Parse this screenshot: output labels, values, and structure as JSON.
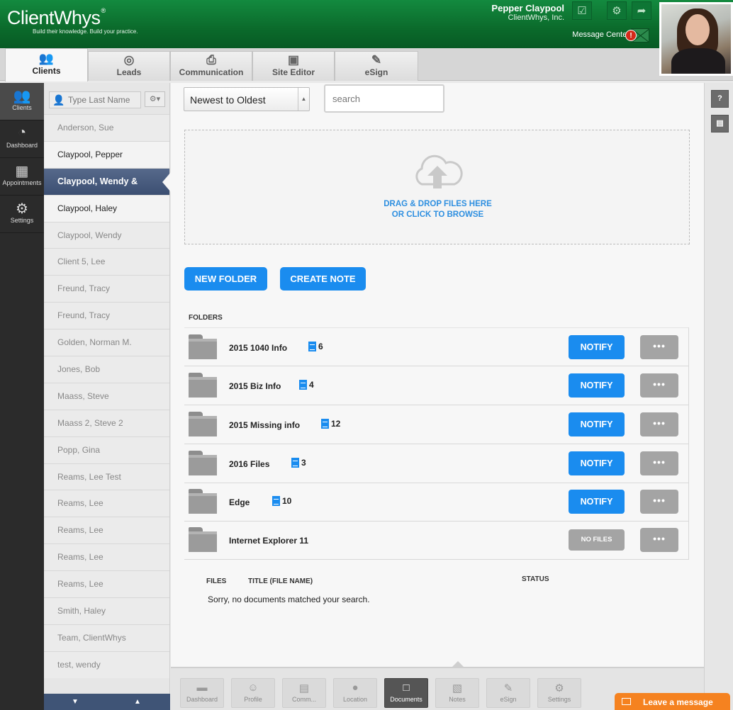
{
  "header": {
    "logo": "ClientWhys",
    "logo_mark": "®",
    "tagline": "Build their knowledge. Build your practice.",
    "user_name": "Pepper Claypool",
    "company": "ClientWhys, Inc.",
    "message_center": "Message Center",
    "message_badge": "!",
    "icons": [
      "checkbox-icon",
      "gear-icon",
      "share-icon"
    ]
  },
  "topnav": {
    "tabs": [
      {
        "label": "Clients",
        "icon": "people-icon",
        "active": true
      },
      {
        "label": "Leads",
        "icon": "target-icon"
      },
      {
        "label": "Communication",
        "icon": "printer-icon"
      },
      {
        "label": "Site Editor",
        "icon": "window-icon"
      },
      {
        "label": "eSign",
        "icon": "pencil-icon"
      }
    ]
  },
  "rail": {
    "items": [
      {
        "label": "Clients",
        "icon": "people-icon",
        "active": true
      },
      {
        "label": "Dashboard",
        "icon": "gauge-icon"
      },
      {
        "label": "Appointments",
        "icon": "calendar-icon"
      },
      {
        "label": "Settings",
        "icon": "gear-icon"
      }
    ]
  },
  "clients": {
    "search_placeholder": "Type Last Name",
    "items": [
      {
        "name": "Anderson, Sue",
        "style": "light"
      },
      {
        "name": "Claypool, Pepper",
        "style": "dark"
      },
      {
        "name": "Claypool, Wendy &",
        "style": "selected"
      },
      {
        "name": "Claypool, Haley",
        "style": "dark"
      },
      {
        "name": "Claypool, Wendy",
        "style": "light"
      },
      {
        "name": "Client 5, Lee",
        "style": "light"
      },
      {
        "name": "Freund, Tracy",
        "style": "light"
      },
      {
        "name": "Freund, Tracy",
        "style": "light"
      },
      {
        "name": "Golden, Norman M.",
        "style": "light"
      },
      {
        "name": "Jones, Bob",
        "style": "light"
      },
      {
        "name": "Maass, Steve",
        "style": "light"
      },
      {
        "name": "Maass 2, Steve 2",
        "style": "light"
      },
      {
        "name": "Popp, Gina",
        "style": "light"
      },
      {
        "name": "Reams, Lee Test",
        "style": "light"
      },
      {
        "name": "Reams, Lee",
        "style": "light"
      },
      {
        "name": "Reams, Lee",
        "style": "light"
      },
      {
        "name": "Reams, Lee",
        "style": "light"
      },
      {
        "name": "Reams, Lee",
        "style": "light"
      },
      {
        "name": "Smith, Haley",
        "style": "light"
      },
      {
        "name": "Team, ClientWhys",
        "style": "light"
      },
      {
        "name": "test, wendy",
        "style": "light"
      }
    ]
  },
  "main": {
    "sort_value": "Newest to Oldest",
    "search_placeholder": "search",
    "drop_line1": "DRAG & DROP FILES HERE",
    "drop_line2": "OR CLICK TO BROWSE",
    "new_folder": "NEW FOLDER",
    "create_note": "CREATE NOTE",
    "folders_label": "FOLDERS",
    "notify_label": "NOTIFY",
    "no_files_label": "NO FILES",
    "more_label": "•••",
    "folders": [
      {
        "name": "2015 1040 Info",
        "count": "6",
        "has_files": true
      },
      {
        "name": "2015 Biz Info",
        "count": "4",
        "has_files": true
      },
      {
        "name": "2015 Missing info",
        "count": "12",
        "has_files": true
      },
      {
        "name": "2016 Files",
        "count": "3",
        "has_files": true
      },
      {
        "name": "Edge",
        "count": "10",
        "has_files": true
      },
      {
        "name": "Internet Explorer 11",
        "count": "",
        "has_files": false
      }
    ],
    "files_col": "FILES",
    "title_col": "TITLE (FILE NAME)",
    "status_col": "STATUS",
    "no_docs": "Sorry, no documents matched your search."
  },
  "bottombar": {
    "items": [
      {
        "label": "Dashboard",
        "icon": "chat-icon"
      },
      {
        "label": "Profile",
        "icon": "profile-icon"
      },
      {
        "label": "Comm...",
        "icon": "newspaper-icon"
      },
      {
        "label": "Location",
        "icon": "map-pin-icon"
      },
      {
        "label": "Documents",
        "icon": "documents-icon",
        "active": true
      },
      {
        "label": "Notes",
        "icon": "note-icon"
      },
      {
        "label": "eSign",
        "icon": "pencil-icon"
      },
      {
        "label": "Settings",
        "icon": "gear-icon"
      }
    ]
  },
  "rightstrip": {
    "help": "?",
    "library_icon": "library-icon"
  },
  "leave_message": "Leave a message",
  "colors": {
    "brand_green": "#0b6a2b",
    "accent_blue": "#1a8cef",
    "selected_navy": "#3c4f72",
    "orange": "#f58220"
  }
}
